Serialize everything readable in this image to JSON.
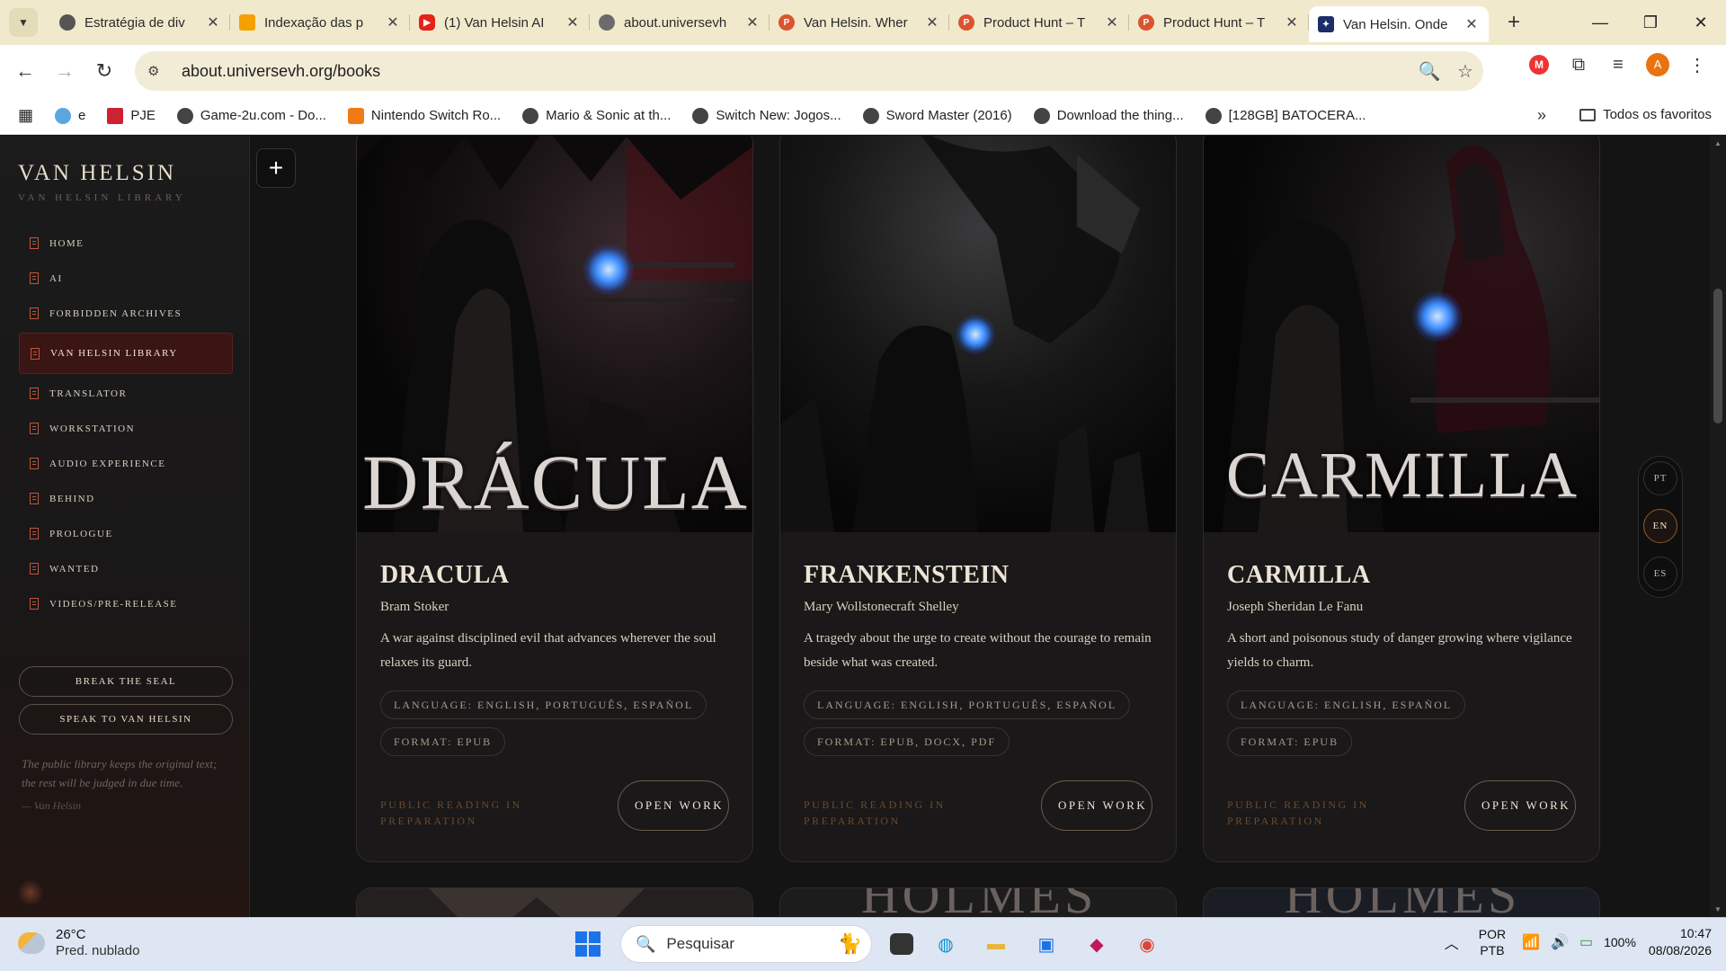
{
  "browser": {
    "tabs": [
      {
        "title": "Estratégia de div",
        "color": "#555555",
        "active": false
      },
      {
        "title": "Indexação das p",
        "color": "#f4a100",
        "active": false
      },
      {
        "title": "(1) Van Helsin AI",
        "color": "#e62117",
        "active": false
      },
      {
        "title": "about.universevh",
        "color": "#6b6b6b",
        "active": false
      },
      {
        "title": "Van Helsin. Wher",
        "color": "#da552f",
        "active": false
      },
      {
        "title": "Product Hunt – T",
        "color": "#da552f",
        "active": false
      },
      {
        "title": "Product Hunt – T",
        "color": "#da552f",
        "active": false
      },
      {
        "title": "Van Helsin. Onde",
        "color": "#1d2d6b",
        "active": true
      }
    ],
    "url": "about.universevh.org/books",
    "avatar_letter": "A",
    "bookmarks": [
      "e",
      "PJE",
      "Game-2u.com - Do...",
      "Nintendo Switch Ro...",
      "Mario & Sonic at th...",
      "Switch New: Jogos...",
      "Sword Master (2016)",
      "Download the thing...",
      "[128GB] BATOCERA..."
    ],
    "all_bookmarks": "Todos os favoritos"
  },
  "sidebar": {
    "brand": "VAN HELSIN",
    "brand_sub": "VAN HELSIN LIBRARY",
    "items": [
      {
        "label": "HOME",
        "active": false
      },
      {
        "label": "AI",
        "active": false
      },
      {
        "label": "FORBIDDEN ARCHIVES",
        "active": false
      },
      {
        "label": "VAN HELSIN LIBRARY",
        "active": true
      },
      {
        "label": "TRANSLATOR",
        "active": false
      },
      {
        "label": "WORKSTATION",
        "active": false
      },
      {
        "label": "AUDIO EXPERIENCE",
        "active": false
      },
      {
        "label": "BEHIND",
        "active": false
      },
      {
        "label": "PROLOGUE",
        "active": false
      },
      {
        "label": "WANTED",
        "active": false
      },
      {
        "label": "VIDEOS/PRE-RELEASE",
        "active": false
      }
    ],
    "break_seal": "BREAK THE SEAL",
    "speak": "SPEAK TO VAN HELSIN",
    "quote": "The public library keeps the original text; the rest will be judged in due time.",
    "signature": "— Van Helsin"
  },
  "books": [
    {
      "cover_title": "DRÁCULA",
      "title": "DRACULA",
      "author": "Bram Stoker",
      "description": "A war against disciplined evil that advances wherever the soul relaxes its guard.",
      "language": "LANGUAGE: ENGLISH, PORTUGUÊS, ESPAÑOL",
      "format": "FORMAT: EPUB",
      "status": "PUBLIC READING IN PREPARATION",
      "action": "OPEN WORK"
    },
    {
      "cover_title": "",
      "title": "FRANKENSTEIN",
      "author": "Mary Wollstonecraft Shelley",
      "description": "A tragedy about the urge to create without the courage to remain beside what was created.",
      "language": "LANGUAGE: ENGLISH, PORTUGUÊS, ESPAÑOL",
      "format": "FORMAT: EPUB, DOCX, PDF",
      "status": "PUBLIC READING IN PREPARATION",
      "action": "OPEN WORK"
    },
    {
      "cover_title": "CARMILLA",
      "title": "CARMILLA",
      "author": "Joseph Sheridan Le Fanu",
      "description": "A short and poisonous study of danger growing where vigilance yields to charm.",
      "language": "LANGUAGE: ENGLISH, ESPAÑOL",
      "format": "FORMAT: EPUB",
      "status": "PUBLIC READING IN PREPARATION",
      "action": "OPEN WORK"
    }
  ],
  "next_row_peeks": [
    "",
    "HOLMES",
    "HOLMES"
  ],
  "languages": [
    {
      "code": "PT",
      "active": false
    },
    {
      "code": "EN",
      "active": true
    },
    {
      "code": "ES",
      "active": false
    }
  ],
  "taskbar": {
    "temp": "26°C",
    "weather": "Pred. nublado",
    "search_placeholder": "Pesquisar",
    "lang_top": "POR",
    "lang_bottom": "PTB",
    "battery": "100%",
    "time": "10:47",
    "date": "08/08/2026"
  },
  "colors": {
    "accent_red": "#3b1414",
    "accent_copper": "#c0543a",
    "page_bg": "#141414",
    "tab_strip": "#f1e9cc"
  }
}
